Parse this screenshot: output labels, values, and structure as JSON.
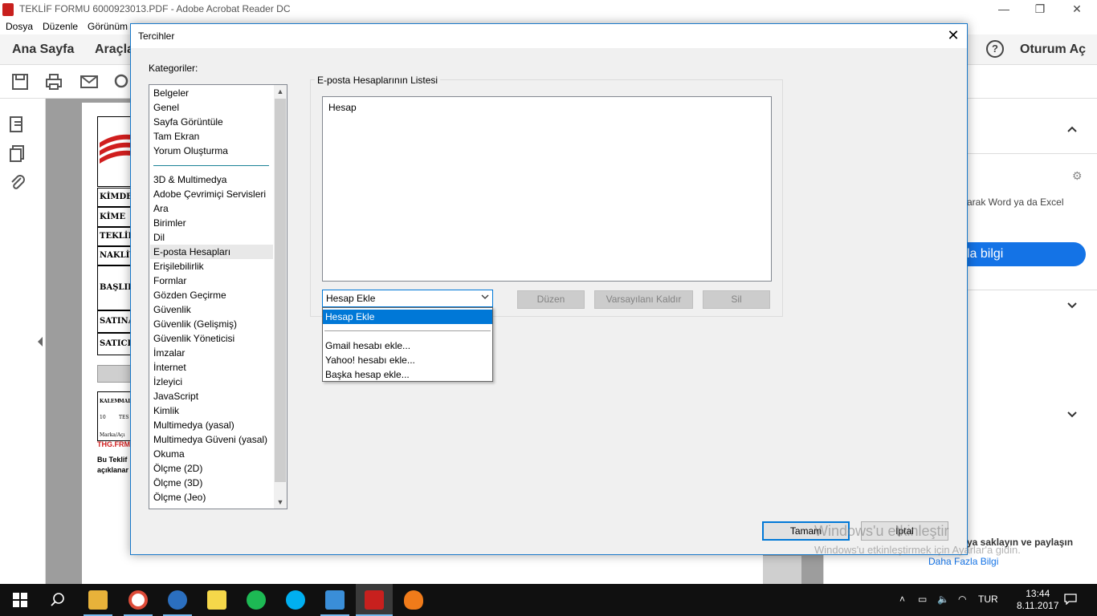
{
  "window": {
    "title": "TEKLİF FORMU 6000923013.PDF - Adobe Acrobat Reader DC",
    "minimize": "—",
    "restore": "❐",
    "close": "✕"
  },
  "menu": [
    "Dosya",
    "Düzenle",
    "Görünüm"
  ],
  "toolbar": {
    "home": "Ana Sayfa",
    "tools": "Araçla",
    "help": "?",
    "sign_in": "Oturum Aç"
  },
  "document": {
    "rows": [
      "KİMDEN",
      "KİME",
      "TEKLİF",
      "NAKLİY",
      "BAŞLIK",
      "SATINA",
      "SATICI"
    ],
    "small_cells": [
      "KALEM",
      "MALZ",
      "10",
      "TES",
      "Marka/Açı"
    ],
    "footer_code": "THG.FRM",
    "footer_text_1": "Bu Teklif",
    "footer_text_2": "açıklanar"
  },
  "right_panel": {
    "text": "arak Word ya da Excel",
    "button": "la bilgi",
    "share_text": "ya saklayın ve paylaşın",
    "more_info": "Daha Fazla Bilgi"
  },
  "dialog": {
    "title": "Tercihler",
    "close": "✕",
    "categories_label": "Kategoriler:",
    "categories_top": [
      "Belgeler",
      "Genel",
      "Sayfa Görüntüle",
      "Tam Ekran",
      "Yorum Oluşturma"
    ],
    "categories": [
      "3D & Multimedya",
      "Adobe Çevrimiçi Servisleri",
      "Ara",
      "Birimler",
      "Dil",
      "E-posta Hesapları",
      "Erişilebilirlik",
      "Formlar",
      "Gözden Geçirme",
      "Güvenlik",
      "Güvenlik (Gelişmiş)",
      "Güvenlik Yöneticisi",
      "İmzalar",
      "İnternet",
      "İzleyici",
      "JavaScript",
      "Kimlik",
      "Multimedya (yasal)",
      "Multimedya Güveni (yasal)",
      "Okuma",
      "Ölçme (2D)",
      "Ölçme (3D)",
      "Ölçme (Jeo)"
    ],
    "selected_category": "E-posta Hesapları",
    "group_label": "E-posta Hesaplarının Listesi",
    "list_header": "Hesap",
    "combo_value": "Hesap Ekle",
    "dropdown_items": [
      "Hesap Ekle",
      "Gmail hesabı ekle...",
      "Yahoo! hesabı ekle...",
      "Başka hesap ekle..."
    ],
    "edit_button": "Düzen",
    "remove_default_button": "Varsayılanı Kaldır",
    "delete_button": "Sil",
    "ok_button": "Tamam",
    "cancel_button": "İptal"
  },
  "watermark": {
    "line1": "Windows'u etkinleştir",
    "line2": "Windows'u etkinleştirmek için Ayarlar'a gidin."
  },
  "taskbar": {
    "language": "TUR",
    "time": "13:44",
    "date": "8.11.2017"
  }
}
